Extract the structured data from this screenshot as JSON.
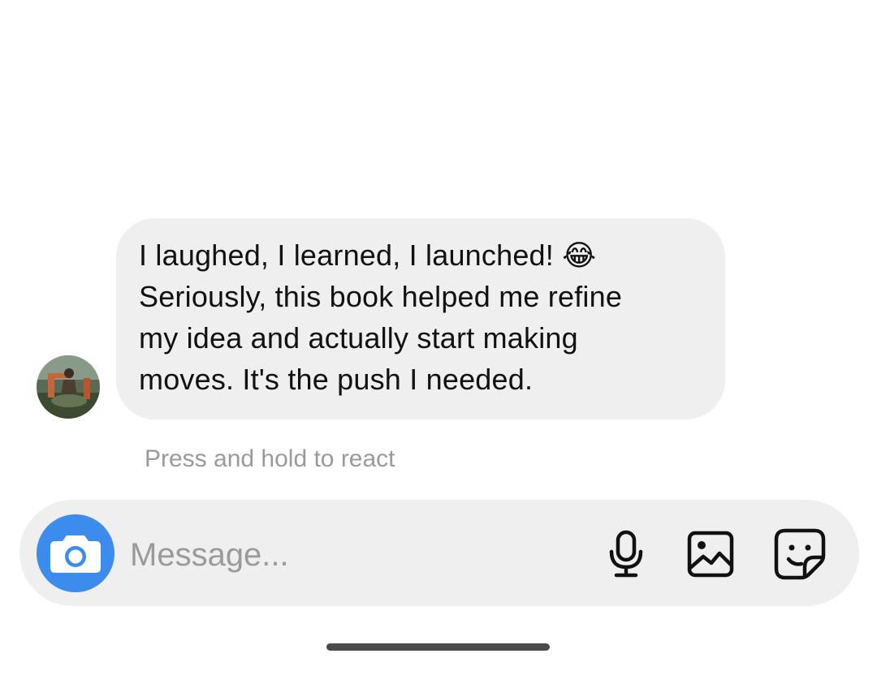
{
  "conversation": {
    "message": {
      "text": "I laughed, I learned, I launched! 😂\nSeriously, this book helped me refine\nmy idea and actually start making\nmoves. It's the push I needed."
    },
    "react_hint": "Press and hold to react"
  },
  "composer": {
    "placeholder": "Message...",
    "icons": {
      "camera": "camera-icon",
      "microphone": "microphone-icon",
      "gallery": "gallery-icon",
      "sticker": "sticker-icon"
    },
    "camera_color": "#3b8ced"
  }
}
